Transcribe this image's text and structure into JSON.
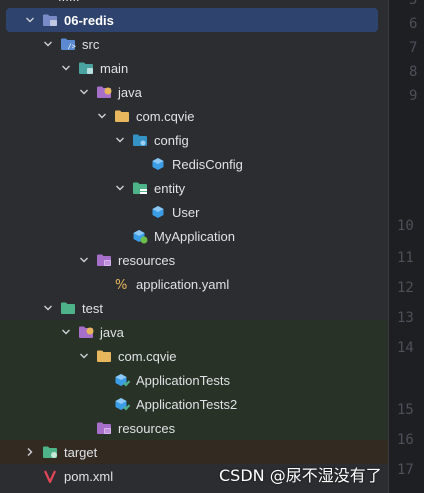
{
  "tree": {
    "partial_top_label": "......",
    "items": [
      {
        "label": "06-redis",
        "depth": 0,
        "expanded": true,
        "icon": "module-folder-icon"
      },
      {
        "label": "src",
        "depth": 1,
        "expanded": true,
        "icon": "source-folder-icon"
      },
      {
        "label": "main",
        "depth": 2,
        "expanded": true,
        "icon": "folder-icon"
      },
      {
        "label": "java",
        "depth": 3,
        "expanded": true,
        "icon": "java-source-root-icon"
      },
      {
        "label": "com.cqvie",
        "depth": 4,
        "expanded": true,
        "icon": "package-icon"
      },
      {
        "label": "config",
        "depth": 5,
        "expanded": true,
        "icon": "config-package-icon"
      },
      {
        "label": "RedisConfig",
        "depth": 6,
        "expanded": null,
        "icon": "class-icon"
      },
      {
        "label": "entity",
        "depth": 5,
        "expanded": true,
        "icon": "entity-package-icon"
      },
      {
        "label": "User",
        "depth": 6,
        "expanded": null,
        "icon": "class-icon"
      },
      {
        "label": "MyApplication",
        "depth": 5,
        "expanded": null,
        "icon": "spring-boot-class-icon"
      },
      {
        "label": "resources",
        "depth": 3,
        "expanded": true,
        "icon": "resources-folder-icon"
      },
      {
        "label": "application.yaml",
        "depth": 4,
        "expanded": null,
        "icon": "yaml-file-icon"
      },
      {
        "label": "test",
        "depth": 1,
        "expanded": true,
        "icon": "test-folder-icon"
      },
      {
        "label": "java",
        "depth": 2,
        "expanded": true,
        "icon": "java-test-root-icon"
      },
      {
        "label": "com.cqvie",
        "depth": 3,
        "expanded": true,
        "icon": "package-icon"
      },
      {
        "label": "ApplicationTests",
        "depth": 4,
        "expanded": null,
        "icon": "test-class-icon"
      },
      {
        "label": "ApplicationTests2",
        "depth": 4,
        "expanded": null,
        "icon": "test-class-icon"
      },
      {
        "label": "resources",
        "depth": 3,
        "expanded": null,
        "icon": "resources-folder-icon"
      },
      {
        "label": "target",
        "depth": 0,
        "expanded": false,
        "icon": "excluded-folder-icon"
      },
      {
        "label": "pom.xml",
        "depth": 0,
        "expanded": null,
        "icon": "maven-file-icon"
      }
    ]
  },
  "gutter": {
    "line_numbers": [
      "5",
      "6",
      "7",
      "8",
      "9",
      "10",
      "11",
      "12",
      "13",
      "14",
      "15",
      "16",
      "17"
    ]
  },
  "watermark": "CSDN @尿不湿没有了",
  "colors": {
    "background": "#2b2d30",
    "selection": "#2e436e",
    "test_highlight": "#283226",
    "target_highlight": "#332a22",
    "folder": "#e8b75d",
    "package_blue": "#3592c4",
    "class_blue": "#3b9de6",
    "java_purple": "#a66fc9",
    "test_green": "#4fb38a"
  }
}
